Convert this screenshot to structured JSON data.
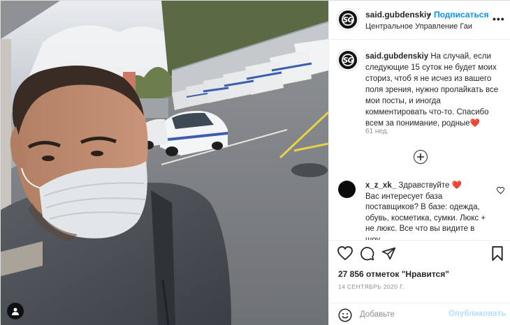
{
  "header": {
    "username": "said.gubdenskiy",
    "separator": "•",
    "follow_label": "Подписаться",
    "location": "Центральное Управление Гаи",
    "more_icon": "more-dots-icon",
    "avatar_text": "SG"
  },
  "caption": {
    "username": "said.gubdenskiy",
    "text": "На случай, если следующие 15 суток не будет моих сториз, чтоб я не исчез из вашего поля зрения, нужно пролайкать все мои посты, и иногда комментировать что-то. Спасибо всем за понимание, родные",
    "emoji": "❤️",
    "time": "61 нед."
  },
  "load_more_icon": "plus-circle-icon",
  "comment": {
    "username": "x_z_xk_",
    "text": "Здравствуйте",
    "emoji": "❤️",
    "body": "Вас интересует база поставщиков? В базе: одежда, обувь, косметика, сумки. Люкс + не люкс. Все что вы видите в шоу"
  },
  "actions": {
    "like_icon": "heart-outline-icon",
    "comment_icon": "comment-bubble-icon",
    "share_icon": "paper-plane-icon",
    "save_icon": "bookmark-icon"
  },
  "likes_text": "27 856 отметок \"Нравится\"",
  "date_text": "14 сентябрь 2020 г.",
  "add_comment": {
    "placeholder": "Добавьте",
    "publish_label": "Опубликовать",
    "emoji_icon": "smiley-icon"
  },
  "colors": {
    "link_blue": "#0095f6",
    "publish_disabled": "#b2dffc",
    "heart_red": "#ed4956"
  }
}
